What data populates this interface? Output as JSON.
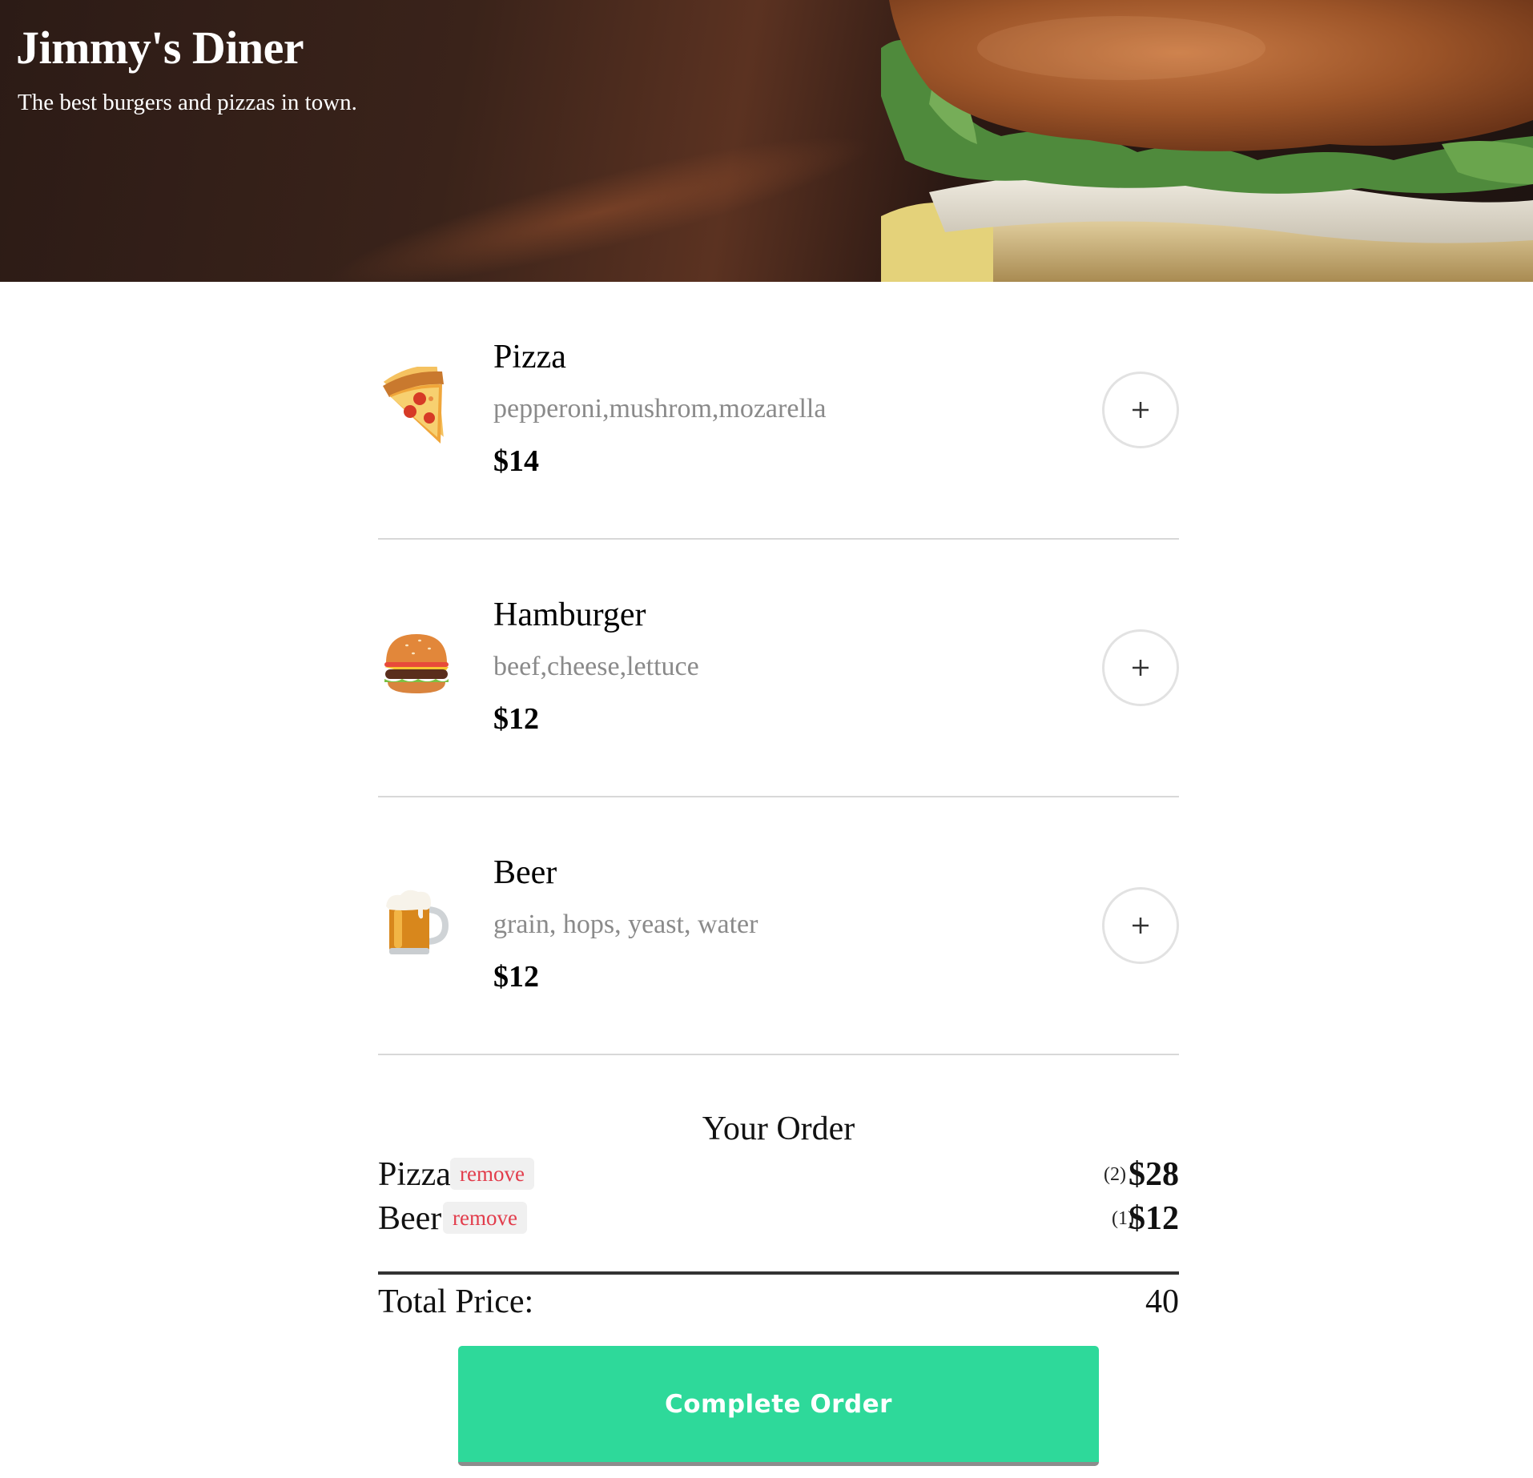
{
  "hero": {
    "title": "Jimmy's Diner",
    "subtitle": "The best burgers and pizzas in town."
  },
  "menu": {
    "items": [
      {
        "name": "Pizza",
        "ingredients": "pepperoni,mushrom,mozarella",
        "price": "$14",
        "icon": "pizza-icon",
        "add_label": "+"
      },
      {
        "name": "Hamburger",
        "ingredients": "beef,cheese,lettuce",
        "price": "$12",
        "icon": "hamburger-icon",
        "add_label": "+"
      },
      {
        "name": "Beer",
        "ingredients": "grain, hops, yeast, water",
        "price": "$12",
        "icon": "beer-icon",
        "add_label": "+"
      }
    ]
  },
  "order": {
    "title": "Your Order",
    "lines": [
      {
        "name": "Pizza",
        "remove_label": "remove",
        "qty": "(2)",
        "price": "$28"
      },
      {
        "name": "Beer",
        "remove_label": "remove",
        "qty": "(1)",
        "price": "$12"
      }
    ],
    "total_label": "Total Price:",
    "total_value": "40",
    "complete_label": "Complete Order"
  },
  "colors": {
    "accent": "#2ed99a",
    "remove_text": "#e23c4b",
    "muted_text": "#8a8a8a"
  }
}
